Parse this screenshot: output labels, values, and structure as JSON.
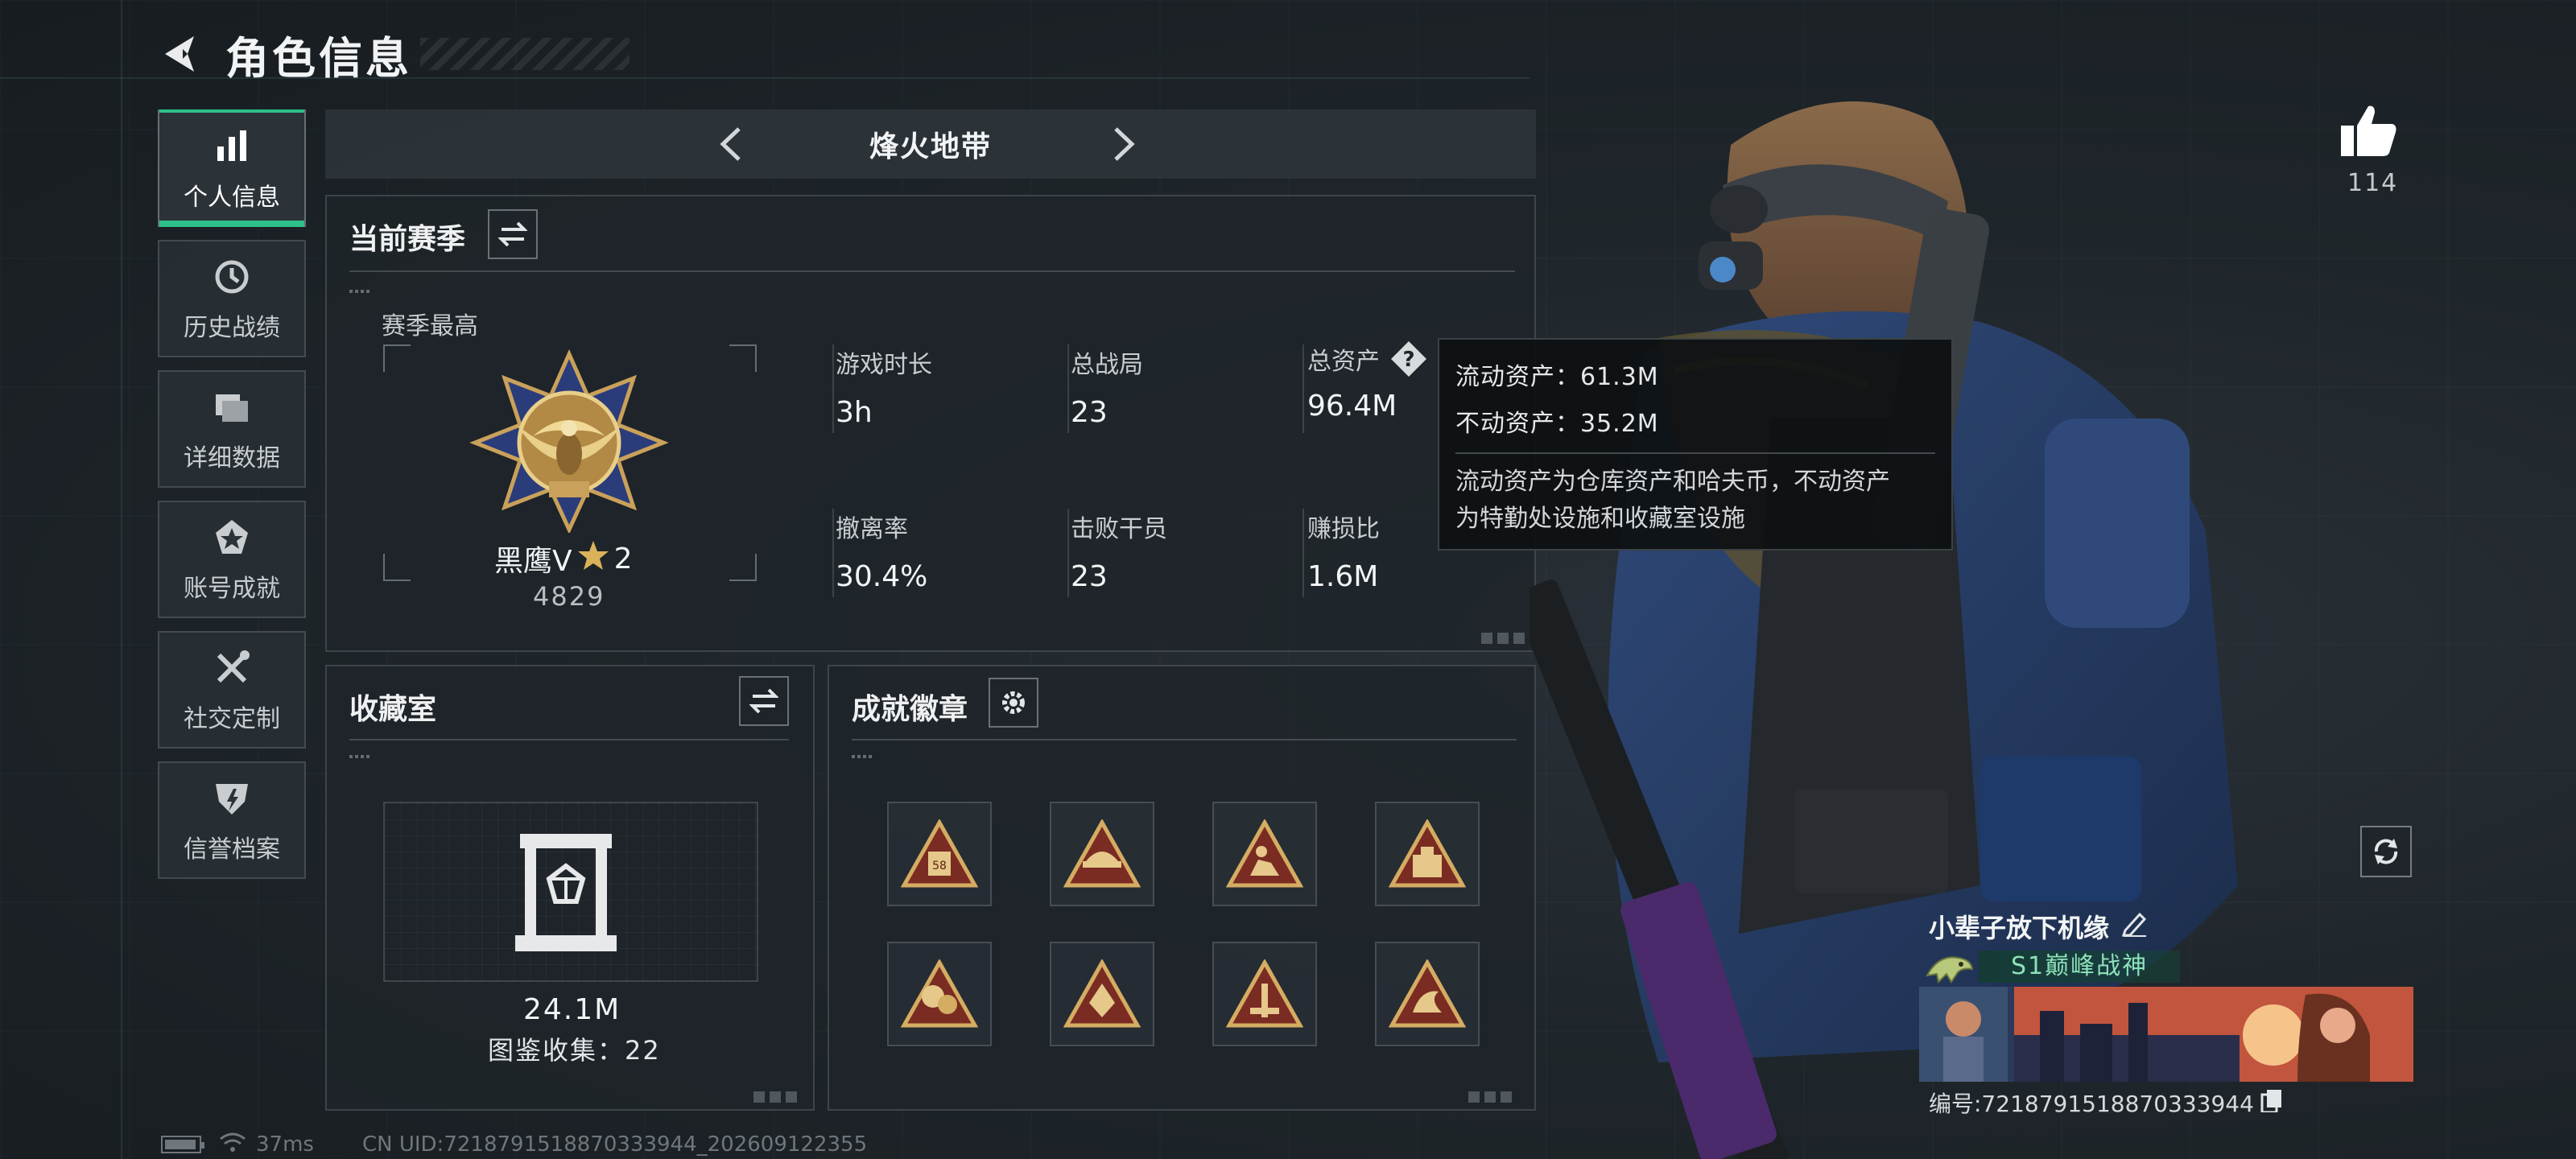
{
  "page": {
    "title": "角色信息"
  },
  "sidebar": {
    "items": [
      {
        "label": "个人信息",
        "icon": "bar-chart-icon",
        "active": true
      },
      {
        "label": "历史战绩",
        "icon": "history-icon",
        "active": false
      },
      {
        "label": "详细数据",
        "icon": "folder-icon",
        "active": false
      },
      {
        "label": "账号成就",
        "icon": "achievement-icon",
        "active": false
      },
      {
        "label": "社交定制",
        "icon": "tools-icon",
        "active": false
      },
      {
        "label": "信誉档案",
        "icon": "credit-icon",
        "active": false
      }
    ]
  },
  "mode": {
    "title": "烽火地带"
  },
  "season": {
    "title": "当前赛季",
    "best_label": "赛季最高",
    "rank_name": "黑鹰V",
    "rank_stars": "2",
    "rank_score": "4829",
    "stats": [
      {
        "label": "游戏时长",
        "value": "3h"
      },
      {
        "label": "总战局",
        "value": "23"
      },
      {
        "label": "总资产",
        "value": "96.4M"
      },
      {
        "label": "撤离率",
        "value": "30.4%"
      },
      {
        "label": "击败干员",
        "value": "23"
      },
      {
        "label": "赚损比",
        "value": "1.6M"
      }
    ]
  },
  "tooltip": {
    "liquid": "流动资产：61.3M",
    "fixed": "不动资产：35.2M",
    "desc_line1": "流动资产为仓库资产和哈夫币，不动资产",
    "desc_line2": "为特勤处设施和收藏室设施"
  },
  "collection": {
    "title": "收藏室",
    "value": "24.1M",
    "count_text": "图鉴收集：22"
  },
  "badges": {
    "title": "成就徽章",
    "items": [
      "badge-icon",
      "badge-icon",
      "badge-icon",
      "badge-icon",
      "badge-icon",
      "badge-icon",
      "badge-icon",
      "badge-icon"
    ]
  },
  "profile": {
    "likes": "114",
    "name": "小辈子放下机缘",
    "title_badge": "S1巅峰战神",
    "id_text": "编号:7218791518870333944"
  },
  "footer": {
    "ping": "37ms",
    "uid": "CN UID:7218791518870333944_202609122355"
  },
  "colors": {
    "accent": "#2ec08a",
    "gold": "#c9a15a",
    "panel": "#1e2429"
  }
}
